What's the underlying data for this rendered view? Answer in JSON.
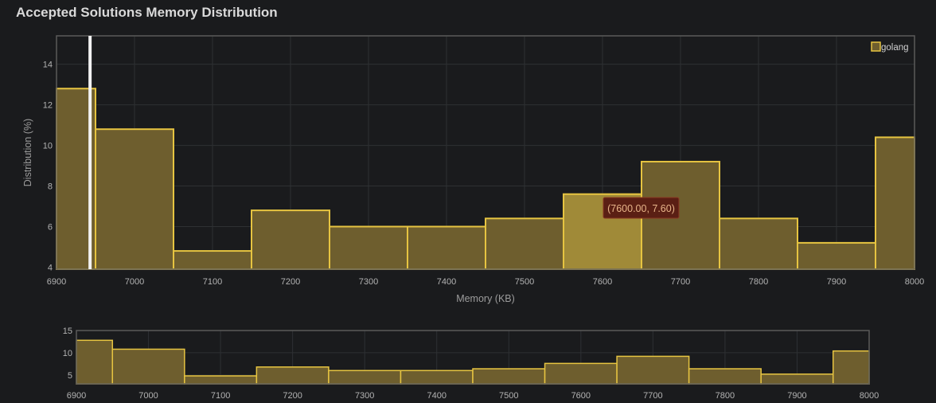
{
  "title": "Accepted Solutions Memory Distribution",
  "colors": {
    "background": "#1a1b1d",
    "bar_fill": "#6e5e2e",
    "bar_stroke": "#e6c441",
    "bar_highlight": "#a08a38",
    "marker": "#f2f2f2",
    "tooltip_bg": "#5a1f14",
    "tooltip_border": "#8a3a22",
    "tooltip_text": "#e8b58a",
    "grid": "#2e3033",
    "frame": "#5a5a5a"
  },
  "chart_data": [
    {
      "type": "bar",
      "role": "main",
      "xlabel": "Memory (KB)",
      "ylabel": "Distribution (%)",
      "xlim": [
        6900,
        8000
      ],
      "ylim": [
        3.9,
        15.4
      ],
      "x_ticks": [
        6900,
        7000,
        7100,
        7200,
        7300,
        7400,
        7500,
        7600,
        7700,
        7800,
        7900,
        8000
      ],
      "y_ticks": [
        4,
        6,
        8,
        10,
        12,
        14
      ],
      "bin_width": 100,
      "bins": [
        6900,
        7000,
        7100,
        7200,
        7300,
        7400,
        7500,
        7600,
        7700,
        7800,
        7900,
        8000
      ],
      "series": [
        {
          "name": "golang",
          "values": [
            12.8,
            10.8,
            4.8,
            6.8,
            6.0,
            6.0,
            6.4,
            7.6,
            9.2,
            6.4,
            5.2,
            10.4
          ]
        }
      ],
      "legend": "top-right",
      "grid": true,
      "marker_x": 6943,
      "highlighted_bin": 7600,
      "tooltip": "(7600.00, 7.60)"
    },
    {
      "type": "bar",
      "role": "overview",
      "xlim": [
        6900,
        8000
      ],
      "ylim": [
        3,
        15
      ],
      "x_ticks": [
        6900,
        7000,
        7100,
        7200,
        7300,
        7400,
        7500,
        7600,
        7700,
        7800,
        7900,
        8000
      ],
      "y_ticks": [
        5,
        10,
        15
      ],
      "bin_width": 100,
      "bins": [
        6900,
        7000,
        7100,
        7200,
        7300,
        7400,
        7500,
        7600,
        7700,
        7800,
        7900,
        8000
      ],
      "values": [
        12.8,
        10.8,
        4.8,
        6.8,
        6.0,
        6.0,
        6.4,
        7.6,
        9.2,
        6.4,
        5.2,
        10.4
      ],
      "grid": true
    }
  ]
}
